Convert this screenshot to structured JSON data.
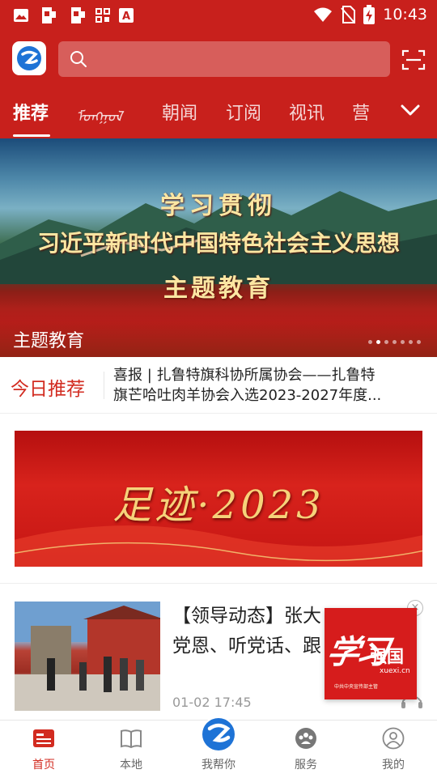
{
  "status_bar": {
    "time": "10:43"
  },
  "header": {
    "search_placeholder": "",
    "tabs": [
      "推荐",
      "ᠮᠣᠩᠭᠣᠯ",
      "朝闻",
      "订阅",
      "视讯",
      "营"
    ],
    "active_tab": "推荐"
  },
  "banner": {
    "line1": "学习贯彻",
    "line2": "习近平新时代中国特色社会主义思想",
    "line3": "主题教育",
    "caption": "主题教育",
    "dot_count": 7,
    "active_dot": 1
  },
  "today": {
    "label": "今日推荐",
    "headline_line1": "喜报 | 扎鲁特旗科协所属协会——扎鲁特",
    "headline_line2": "旗芒哈吐肉羊协会入选2023-2027年度..."
  },
  "feature_banner": {
    "title": "足迹·2023"
  },
  "news": {
    "title_line1": "【领导动态】张大",
    "title_line2": "党恩、听党话、跟",
    "time": "01-02 17:45",
    "close_glyph": "×"
  },
  "ad": {
    "hand": "学习",
    "brand": "强国",
    "url": "xuexi.cn",
    "line": "中共中央宣传部主管"
  },
  "bottom_nav": [
    {
      "label": "首页",
      "icon": "home-news-icon"
    },
    {
      "label": "本地",
      "icon": "book-icon"
    },
    {
      "label": "我帮你",
      "icon": "app-logo-icon"
    },
    {
      "label": "服务",
      "icon": "service-icon"
    },
    {
      "label": "我的",
      "icon": "profile-icon"
    }
  ],
  "colors": {
    "brand_red": "#c8201c",
    "active_red": "#d22b20"
  }
}
